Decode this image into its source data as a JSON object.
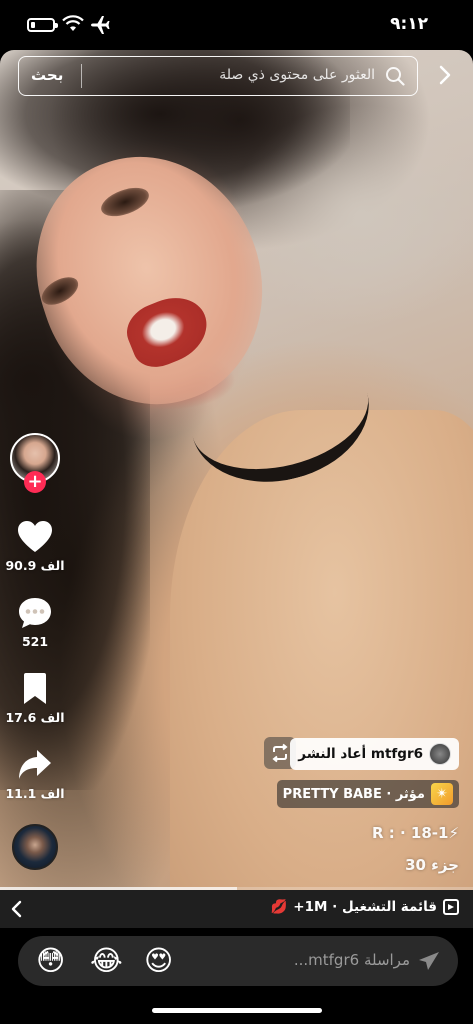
{
  "status_bar": {
    "time": "٩:١٢",
    "battery_level": 0.2,
    "icons": [
      "battery-icon",
      "wifi-icon",
      "airplane-icon"
    ]
  },
  "search": {
    "placeholder": "العثور على محتوى ذي صلة",
    "button_label": "بحث",
    "back_icon": "chevron-right-icon"
  },
  "side_actions": {
    "like_count": "90.9 الف",
    "comment_count": "521",
    "save_count": "17.6 الف",
    "share_count": "11.1 الف",
    "follow_symbol": "+"
  },
  "overlay": {
    "repost_text": "mtfgr6 أعاد النشر",
    "effect_label": "مؤثر · PRETTY BABE",
    "effect_symbol": "✴",
    "caption_line1": "⚡R : · 18-1",
    "caption_line2": "جزء 30"
  },
  "progress": 0.5,
  "playlist": {
    "text": "قائمة التشغيل · 1M+",
    "emoji": "💋"
  },
  "message": {
    "placeholder": "مراسلة mtfgr6...",
    "emojis": [
      "😍",
      "😂",
      "😳"
    ]
  },
  "colors": {
    "accent": "#fe2c55",
    "background": "#000000",
    "playlist_bar": "#1f1f1f",
    "input_bg": "#2a2a2a"
  }
}
